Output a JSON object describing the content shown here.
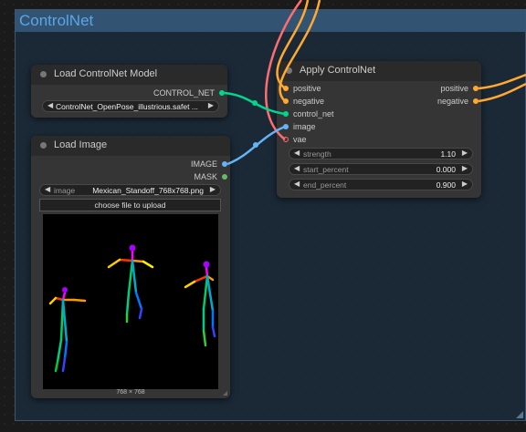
{
  "group": {
    "title": "ControlNet"
  },
  "load_controlnet": {
    "title": "Load ControlNet Model",
    "output_label": "CONTROL_NET",
    "model_value": "ControlNet_OpenPose_illustrious.safet ..."
  },
  "load_image": {
    "title": "Load Image",
    "outputs": {
      "image": "IMAGE",
      "mask": "MASK"
    },
    "image_widget": {
      "name": "image",
      "value": "Mexican_Standoff_768x768.png"
    },
    "upload_label": "choose file to upload",
    "preview_caption": "768 × 768"
  },
  "apply_controlnet": {
    "title": "Apply ControlNet",
    "inputs": [
      "positive",
      "negative",
      "control_net",
      "image",
      "vae"
    ],
    "outputs": [
      "positive",
      "negative"
    ],
    "widgets": [
      {
        "name": "strength",
        "value": "1.10"
      },
      {
        "name": "start_percent",
        "value": "0.000"
      },
      {
        "name": "end_percent",
        "value": "0.900"
      }
    ]
  },
  "colors": {
    "conditioning": "#ffa931",
    "control_net": "#00d78d",
    "image": "#64b5f6",
    "vae": "#ff6e6e",
    "group_title": "#5aa5e8"
  },
  "icons": {
    "left_arrow": "◀",
    "right_arrow": "▶"
  }
}
